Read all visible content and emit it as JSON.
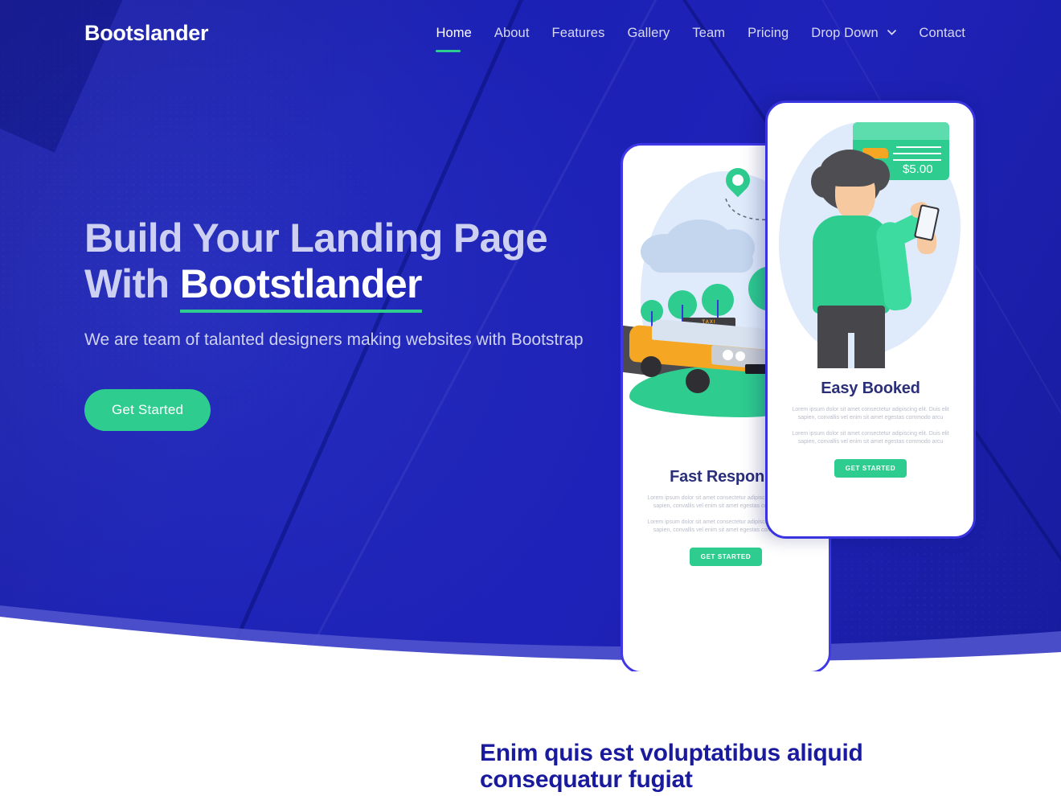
{
  "nav": {
    "brand": "Bootslander",
    "items": [
      {
        "label": "Home",
        "active": true
      },
      {
        "label": "About",
        "active": false
      },
      {
        "label": "Features",
        "active": false
      },
      {
        "label": "Gallery",
        "active": false
      },
      {
        "label": "Team",
        "active": false
      },
      {
        "label": "Pricing",
        "active": false
      },
      {
        "label": "Drop Down",
        "active": false,
        "has_dropdown": true
      },
      {
        "label": "Contact",
        "active": false
      }
    ],
    "chevron": "⌄"
  },
  "hero": {
    "title_line1": "Build Your Landing Page",
    "title_line2_prefix": "With ",
    "title_highlight": "Bootstlander",
    "subtitle": "We are team of talanted designers making websites with Bootstrap",
    "cta_label": "Get Started",
    "background_color": "#1a1eb0",
    "accent_color": "#2ecc8f",
    "title_color": "#cdd0f0"
  },
  "cards": {
    "left": {
      "title": "Fast Response",
      "paragraph1": "Lorem ipsum dolor sit amet consectetur adipiscing elit. Duis elit sapien, convallis vel enim sit amet egestas commodo arcu",
      "paragraph2": "Lorem ipsum dolor sit amet consectetur adipiscing elit. Duis elit sapien, convallis vel enim sit amet egestas commodo arcu",
      "button_label": "GET STARTED"
    },
    "right": {
      "title": "Easy Booked",
      "paragraph1": "Lorem ipsum dolor sit amet consectetur adipiscing elit. Duis elit sapien, convallis vel enim sit amet egestas commodo arcu",
      "paragraph2": "Lorem ipsum dolor sit amet consectetur adipiscing elit. Duis elit sapien, convallis vel enim sit amet egestas commodo arcu",
      "button_label": "GET STARTED",
      "price": "$5.00"
    }
  },
  "bottom": {
    "heading": "Enim quis est voluptatibus aliquid consequatur fugiat",
    "heading_color": "#1a1a9e"
  }
}
